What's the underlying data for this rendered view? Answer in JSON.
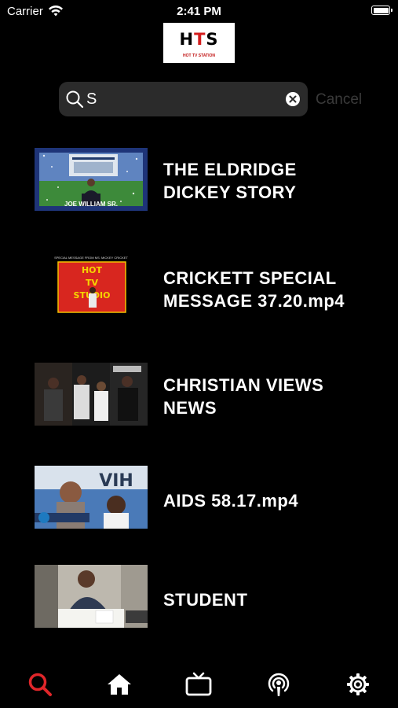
{
  "status_bar": {
    "carrier": "Carrier",
    "time": "2:41 PM"
  },
  "logo": {
    "letters": [
      "H",
      "T",
      "S"
    ],
    "tagline": "HOT TV STATION",
    "colors": {
      "primary": "#000000",
      "accent": "#d41d1d"
    }
  },
  "search": {
    "value": "S",
    "cancel_label": "Cancel"
  },
  "results": [
    {
      "title_lines": [
        "THE ELDRIDGE",
        "DICKEY STORY"
      ],
      "thumb_caption": "JOE WILLIAM SR."
    },
    {
      "title_lines": [
        "CRICKETT SPECIAL",
        "MESSAGE 37.20.mp4"
      ],
      "thumb_caption": "SPECIAL MESSAGE FROM MS. MICKEY CRICKET"
    },
    {
      "title_lines": [
        "CHRISTIAN VIEWS",
        "NEWS"
      ],
      "thumb_caption": ""
    },
    {
      "title_lines": [
        "AIDS 58.17.mp4"
      ],
      "thumb_caption": ""
    },
    {
      "title_lines": [
        "STUDENT"
      ],
      "thumb_caption": ""
    }
  ],
  "tabbar": {
    "active_color": "#e0262a",
    "inactive_color": "#ffffff",
    "tabs": [
      {
        "icon": "search-icon",
        "active": true
      },
      {
        "icon": "home-icon",
        "active": false
      },
      {
        "icon": "tv-icon",
        "active": false
      },
      {
        "icon": "podcast-icon",
        "active": false
      },
      {
        "icon": "gear-icon",
        "active": false
      }
    ]
  }
}
